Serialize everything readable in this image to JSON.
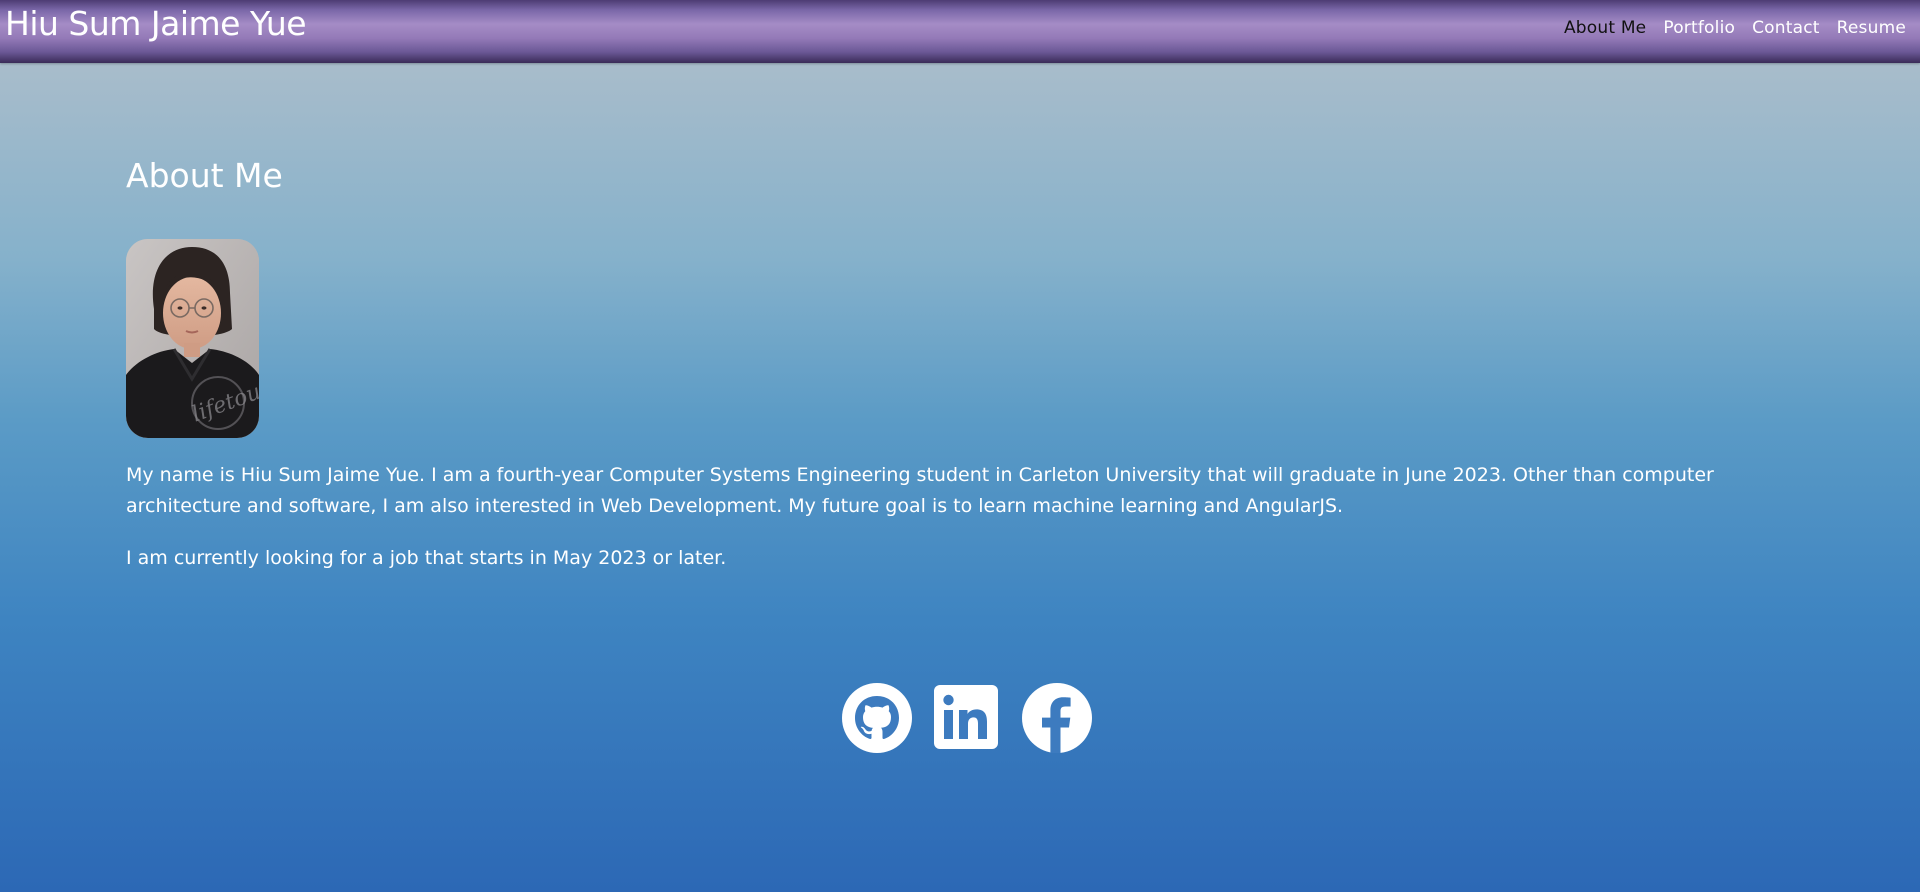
{
  "header": {
    "brand": "Hiu Sum Jaime Yue",
    "nav": [
      {
        "label": "About Me",
        "active": true
      },
      {
        "label": "Portfolio",
        "active": false
      },
      {
        "label": "Contact",
        "active": false
      },
      {
        "label": "Resume",
        "active": false
      }
    ]
  },
  "main": {
    "title": "About Me",
    "profile_photo_alt": "Portrait photo of Hiu Sum Jaime Yue",
    "paragraphs": [
      "My name is Hiu Sum Jaime Yue. I am a fourth-year Computer Systems Engineering student in Carleton University that will graduate in June 2023. Other than computer architecture and software, I am also interested in Web Development. My future goal is to learn machine learning and AngularJS.",
      "I am currently looking for a job that starts in May 2023 or later."
    ]
  },
  "socials": [
    {
      "icon": "github-icon"
    },
    {
      "icon": "linkedin-icon"
    },
    {
      "icon": "facebook-icon"
    }
  ],
  "colors": {
    "header_top": "#4d3c73",
    "header_mid": "#a58cc6",
    "background_top": "#b6c2c8",
    "background_bottom": "#2c68b5",
    "active_nav": "#111111",
    "text": "#ffffff"
  }
}
